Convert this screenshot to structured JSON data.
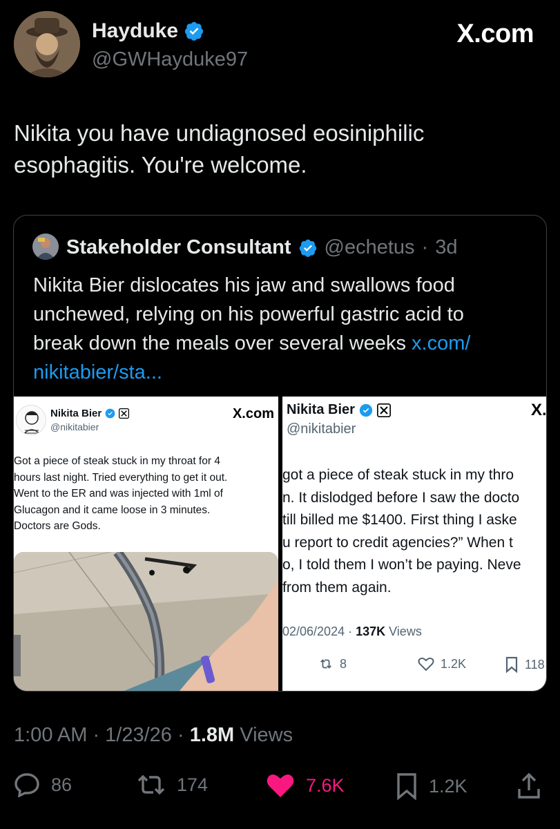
{
  "author": {
    "name": "Hayduke",
    "handle": "@GWHayduke97",
    "verified": true
  },
  "brand": "X.com",
  "tweet": {
    "text_line1": "Nikita you have undiagnosed eosiniphilic",
    "text_line2": "esophagitis. You're welcome."
  },
  "quote": {
    "name": "Stakeholder Consultant",
    "handle": "@echetus",
    "sep": "·",
    "age": "3d",
    "line1": "Nikita Bier dislocates his jaw and swallows food",
    "line2": "unchewed, relying on his powerful gastric acid to",
    "line3_text": "break down the meals over several weeks ",
    "line3_link": "x.com/",
    "line4_link": "nikitabier/sta..."
  },
  "screenshot1": {
    "name": "Nikita Bier",
    "handle": "@nikitabier",
    "brand": "X.com",
    "lines": [
      "Got a piece of steak stuck in my throat for 4",
      "hours last night. Tried everything to get it out.",
      "Went to the ER and was injected with 1ml of",
      "Glucagon and it came loose in 3 minutes.",
      "Doctors are Gods."
    ]
  },
  "screenshot2": {
    "name": "Nikita Bier",
    "handle": "@nikitabier",
    "brand": "X.",
    "lines": [
      "got a piece of steak stuck in my thro",
      "n. It dislodged before I saw the docto",
      "till billed me $1400. First thing I aske",
      "u report to credit agencies?” When t",
      "o, I told them I won’t be paying. Neve",
      "from them again."
    ],
    "date": "02/06/2024 · ",
    "views_count": "137K",
    "views_label": " Views",
    "retweets": "8",
    "likes": "1.2K",
    "bookmarks": "118"
  },
  "meta": {
    "time": "1:00 AM · 1/23/26 · ",
    "views_count": "1.8M",
    "views_label": " Views"
  },
  "actions": {
    "replies": "86",
    "reposts": "174",
    "likes": "7.6K",
    "bookmarks": "1.2K"
  },
  "colors": {
    "background": "#000000",
    "link": "#1d9bf0",
    "like": "#f91880",
    "verified": "#1d9bf0",
    "muted": "#71767b"
  }
}
